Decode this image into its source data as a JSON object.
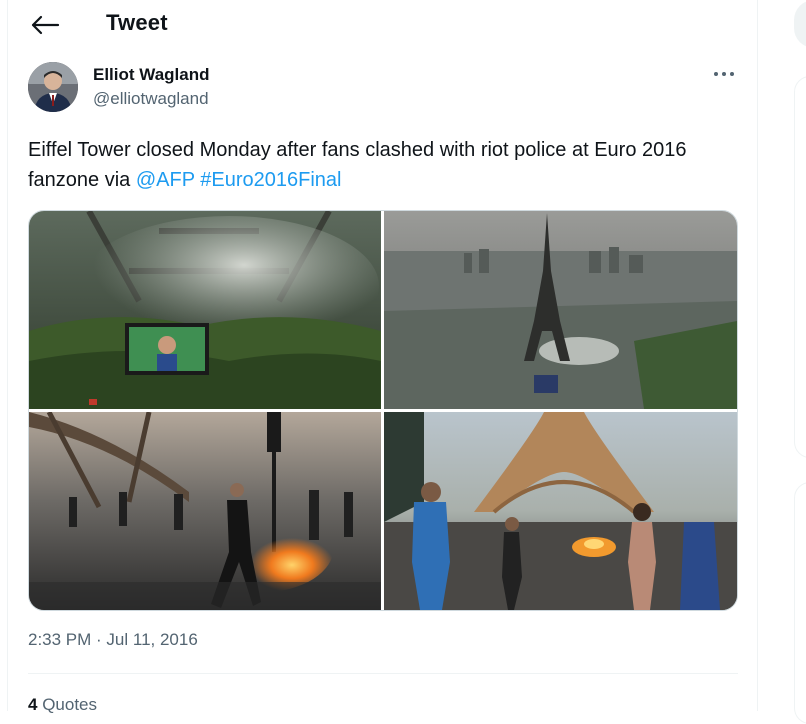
{
  "header": {
    "title": "Tweet",
    "back_icon": "arrow-left-icon"
  },
  "author": {
    "name": "Elliot Wagland",
    "handle": "@elliotwagland",
    "avatar": "profile-photo"
  },
  "tweet": {
    "text_plain": "Eiffel Tower closed Monday after fans clashed with riot police at Euro 2016 fanzone via ",
    "mention": "@AFP",
    "hashtag": "#Euro2016Final",
    "timestamp": "2:33 PM · Jul 11, 2016"
  },
  "media": [
    {
      "name": "fanzone-crowd-screen-photo"
    },
    {
      "name": "eiffel-tower-smoke-aerial-photo"
    },
    {
      "name": "riot-fire-street-photo"
    },
    {
      "name": "tower-fire-crowd-photo"
    }
  ],
  "stats": {
    "quotes_count": "4",
    "quotes_label": "Quotes"
  },
  "colors": {
    "link": "#1d9bf0",
    "secondary_text": "#536471",
    "border": "#cfd9de"
  }
}
